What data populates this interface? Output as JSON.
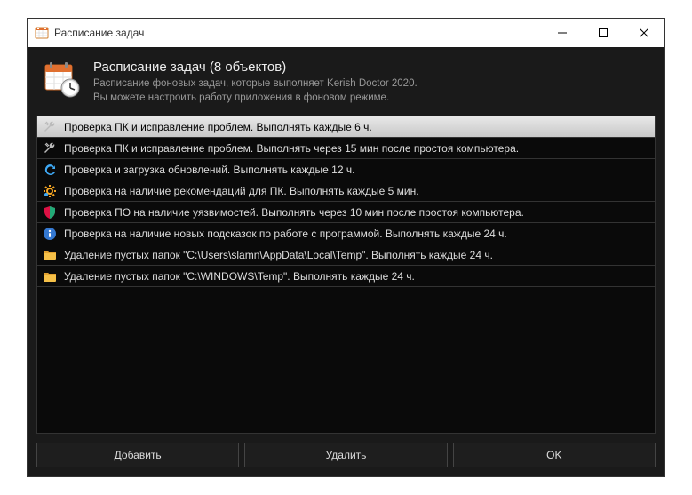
{
  "titlebar": {
    "title": "Расписание задач"
  },
  "header": {
    "title": "Расписание задач (8 объектов)",
    "desc1": "Расписание фоновых задач, которые выполняет Kerish Doctor 2020.",
    "desc2": "Вы можете настроить работу приложения в фоновом режиме."
  },
  "tasks": [
    {
      "icon": "wrench",
      "selected": true,
      "text": "Проверка ПК и исправление проблем. Выполнять каждые 6 ч."
    },
    {
      "icon": "wrench",
      "selected": false,
      "text": "Проверка ПК и исправление проблем. Выполнять через 15 мин после простоя компьютера."
    },
    {
      "icon": "refresh",
      "selected": false,
      "text": "Проверка и загрузка обновлений. Выполнять каждые 12 ч."
    },
    {
      "icon": "gear",
      "selected": false,
      "text": "Проверка на наличие рекомендаций для ПК. Выполнять каждые 5 мин."
    },
    {
      "icon": "shield",
      "selected": false,
      "text": "Проверка ПО на наличие уязвимостей. Выполнять через 10 мин после простоя компьютера."
    },
    {
      "icon": "info",
      "selected": false,
      "text": "Проверка на наличие новых подсказок по работе с программой. Выполнять каждые 24 ч."
    },
    {
      "icon": "folder",
      "selected": false,
      "text": "Удаление пустых папок \"C:\\Users\\slamn\\AppData\\Local\\Temp\". Выполнять каждые 24 ч."
    },
    {
      "icon": "folder",
      "selected": false,
      "text": "Удаление пустых папок \"C:\\WINDOWS\\Temp\". Выполнять каждые 24 ч."
    }
  ],
  "footer": {
    "add": "Добавить",
    "remove": "Удалить",
    "ok": "OK"
  }
}
